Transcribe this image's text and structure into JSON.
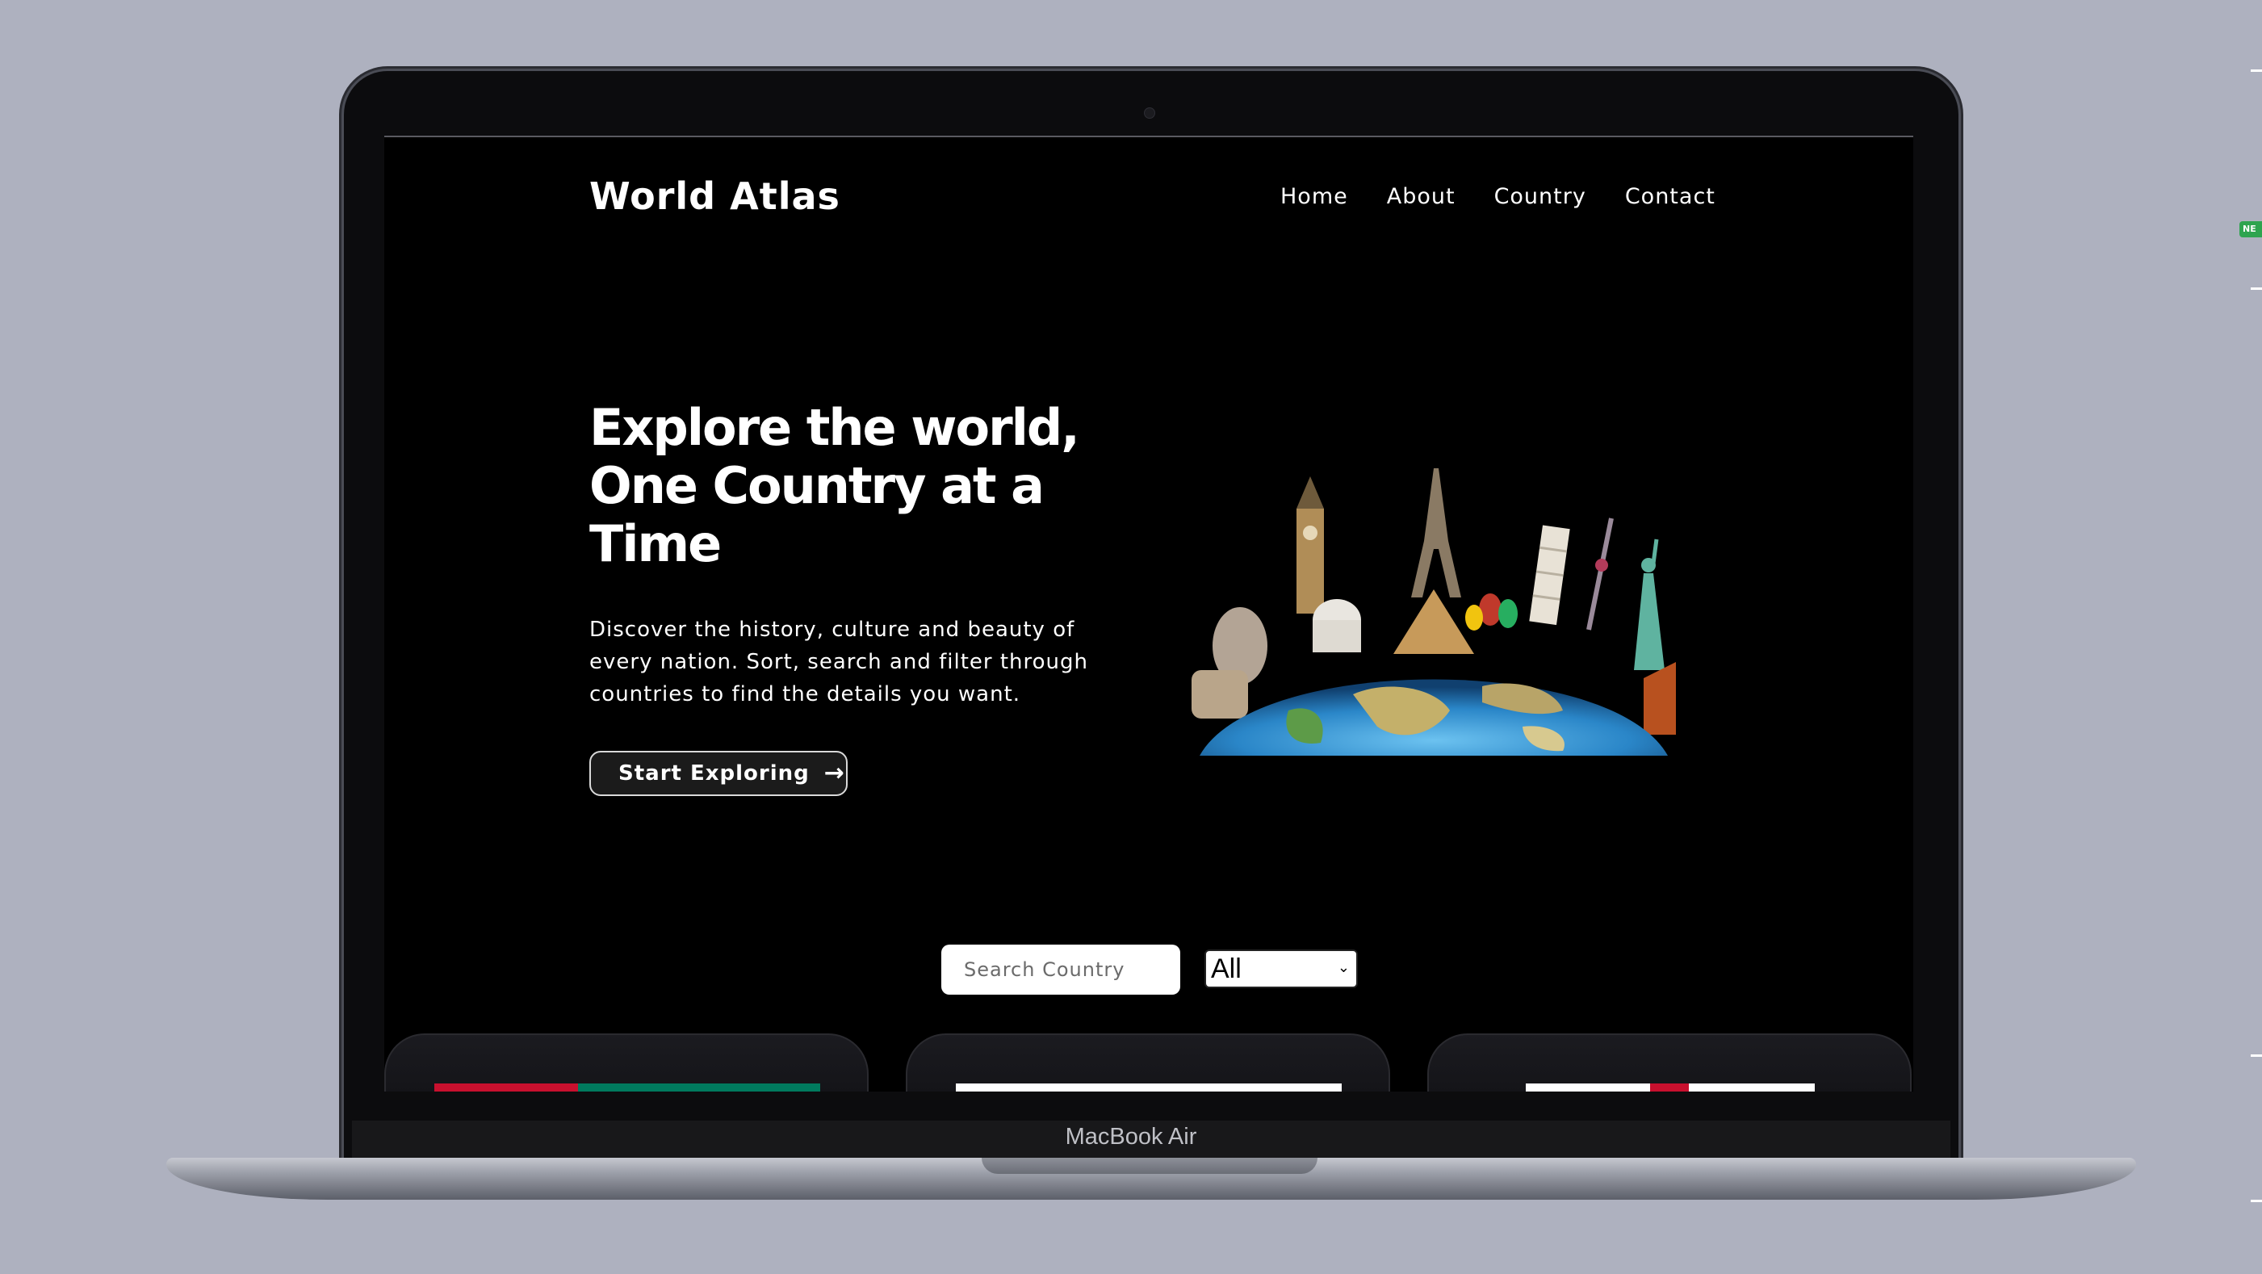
{
  "device": {
    "model_label": "MacBook Air"
  },
  "site": {
    "brand": "World Atlas",
    "nav": [
      {
        "label": "Home"
      },
      {
        "label": "About"
      },
      {
        "label": "Country"
      },
      {
        "label": "Contact"
      }
    ]
  },
  "hero": {
    "title": "Explore the world, One Country at a Time",
    "description": "Discover the history, culture and beauty of every nation. Sort, search and filter through countries to find the details you want.",
    "cta_label": "Start Exploring",
    "cta_icon": "arrow-right-icon",
    "image": "world-landmarks-globe"
  },
  "filters": {
    "search_placeholder": "Search Country",
    "region_selected": "All"
  },
  "side_window": {
    "badge": "NE"
  },
  "colors": {
    "page_bg": "#aeb1bf",
    "screen_bg": "#000000",
    "card_bg": "#16161a",
    "flag_red": "#c8102e",
    "flag_green": "#007a5e",
    "flag_white": "#ffffff"
  }
}
